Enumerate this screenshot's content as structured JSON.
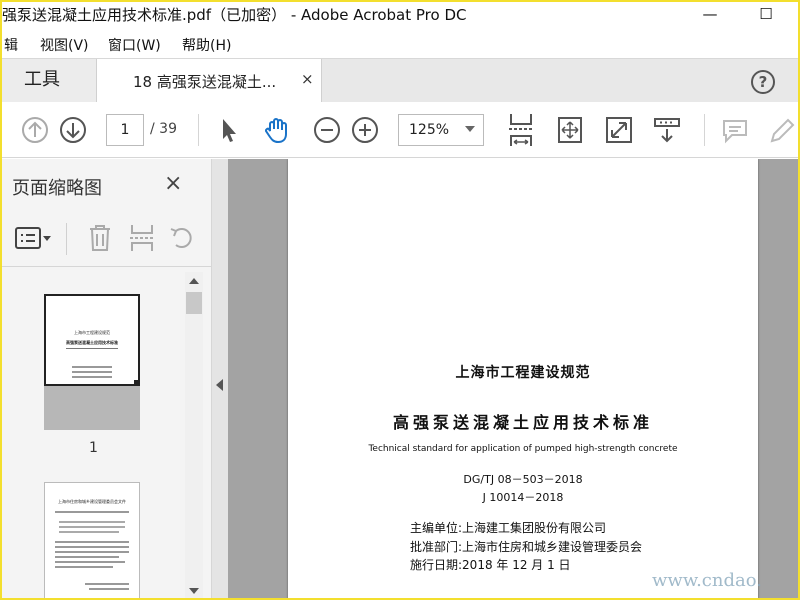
{
  "window": {
    "title": "强泵送混凝土应用技术标准.pdf（已加密） - Adobe Acrobat Pro DC",
    "minimize": "—",
    "maximize": "☐"
  },
  "menu": [
    "辑",
    "视图(V)",
    "窗口(W)",
    "帮助(H)"
  ],
  "tabs": {
    "tools": "工具",
    "document": "18 高强泵送混凝土...",
    "close": "×",
    "help": "?"
  },
  "toolbar": {
    "current_page": "1",
    "total_pages": "/ 39",
    "zoom": "125%"
  },
  "thumbnails_panel": {
    "title": "页面缩略图",
    "close": "×",
    "pages": [
      {
        "label": "1"
      }
    ],
    "thumb1_lines": [
      "上海市工程建设规范",
      "高强泵送混凝土应用技术标准"
    ],
    "thumb2_lines": [
      "上海市住房和城乡建设管理委员会文件"
    ]
  },
  "document": {
    "heading": "上海市工程建设规范",
    "title": "高强泵送混凝土应用技术标准",
    "subtitle_en": "Technical standard for application of pumped high-strength concrete",
    "code1": "DG/TJ 08－503－2018",
    "code2": "J 10014－2018",
    "editor": "主编单位:上海建工集团股份有限公司",
    "approver": "批准部门:上海市住房和城乡建设管理委员会",
    "date": "施行日期:2018 年 12 月 1 日"
  },
  "watermark": "www.cndao.",
  "colors": {
    "frame": "#f3df2e",
    "active_icon": "#1a73c8",
    "doc_background": "#a3a3a3"
  },
  "icons": [
    "arrow-up-icon",
    "arrow-down-icon",
    "select-arrow-icon",
    "hand-icon",
    "zoom-out-icon",
    "zoom-in-icon",
    "fit-page-icon",
    "scroll-mode-icon",
    "fullscreen-icon",
    "read-mode-icon",
    "comment-icon",
    "pen-icon",
    "options-icon",
    "trash-icon",
    "insert-page-icon",
    "rotate-icon",
    "collapse-left-icon"
  ]
}
